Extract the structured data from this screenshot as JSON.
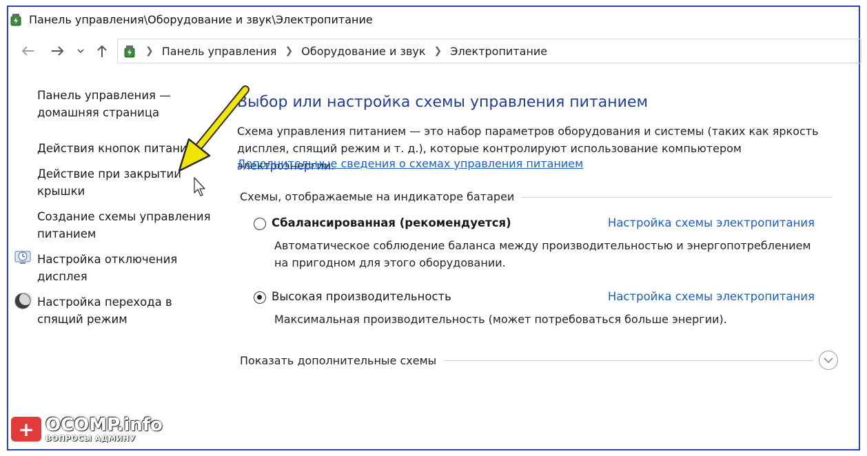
{
  "window": {
    "title": "Панель управления\\Оборудование и звук\\Электропитание"
  },
  "nav": {
    "back_icon": "back-arrow-icon",
    "forward_icon": "forward-arrow-icon",
    "recent_icon": "chevron-down-icon",
    "up_icon": "up-arrow-icon",
    "breadcrumbs": [
      "Панель управления",
      "Оборудование и звук",
      "Электропитание"
    ]
  },
  "sidebar": {
    "items": [
      {
        "line1": "Панель управления —",
        "line2": "домашняя страница"
      },
      {
        "line1": "Действия кнопок питания",
        "line2": ""
      },
      {
        "line1": "Действие при закрытии",
        "line2": "крышки"
      },
      {
        "line1": "Создание схемы управления",
        "line2": "питанием"
      },
      {
        "line1": "Настройка отключения",
        "line2": "дисплея",
        "icon": "display-clock-icon"
      },
      {
        "line1": "Настройка перехода в",
        "line2": "спящий режим",
        "icon": "moon-icon"
      }
    ]
  },
  "main": {
    "title": "Выбор или настройка схемы управления питанием",
    "description": "Схема управления питанием — это набор параметров оборудования и системы (таких как яркость дисплея, спящий режим и т. д.), которые контролируют использование компьютером электроэнергии.",
    "more_info_link": "Дополнительные сведения о схемах управления питанием",
    "battery_section_label": "Схемы, отображаемые на индикаторе батареи",
    "schemes": [
      {
        "name": "Сбалансированная (рекомендуется)",
        "selected": false,
        "configure_link": "Настройка схемы электропитания",
        "description": "Автоматическое соблюдение баланса между производительностью и энергопотреблением на пригодном для этого оборудовании."
      },
      {
        "name": "Высокая производительность",
        "selected": true,
        "configure_link": "Настройка схемы электропитания",
        "description": "Максимальная производительность (может потребоваться больше энергии)."
      }
    ],
    "show_more_label": "Показать дополнительные схемы"
  },
  "watermark": {
    "brand": "OCOMP.info",
    "subtitle": "ВОПРОСЫ АДМИНУ"
  },
  "colors": {
    "title_blue": "#1f3e97",
    "link_blue": "#1b5dc8",
    "frame_border": "#2a3fbd",
    "annotation_arrow": "#f2e600"
  }
}
